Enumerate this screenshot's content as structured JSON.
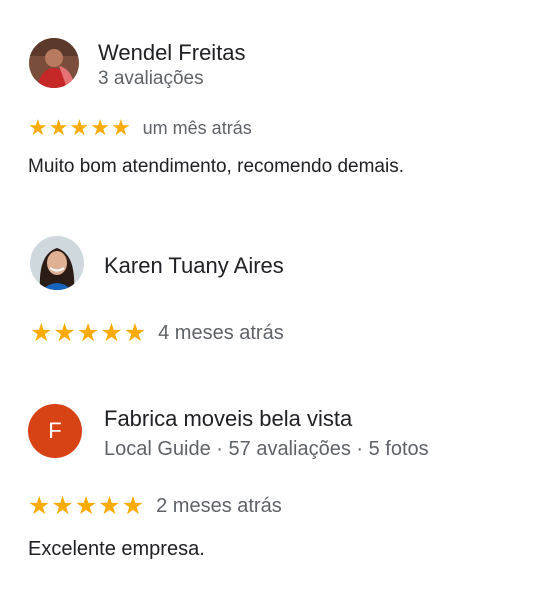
{
  "reviews": [
    {
      "name": "Wendel Freitas",
      "meta": "3 avaliações",
      "time": "um mês atrás",
      "text": "Muito bom atendimento, recomendo demais.",
      "stars": [
        "★",
        "★",
        "★",
        "★",
        "★"
      ]
    },
    {
      "name": "Karen Tuany Aires",
      "time": "4 meses atrás",
      "stars": [
        "★",
        "★",
        "★",
        "★",
        "★"
      ]
    },
    {
      "name": "Fabrica moveis bela vista",
      "meta": "Local Guide · 57 avaliações · 5 fotos",
      "initial": "F",
      "avatar_color": "#d84315",
      "time": "2 meses atrás",
      "text": "Excelente empresa.",
      "stars": [
        "★",
        "★",
        "★",
        "★",
        "★"
      ]
    }
  ],
  "colors": {
    "star": "#f9ab00",
    "secondary_text": "#5f6368",
    "primary_text": "#202124"
  }
}
